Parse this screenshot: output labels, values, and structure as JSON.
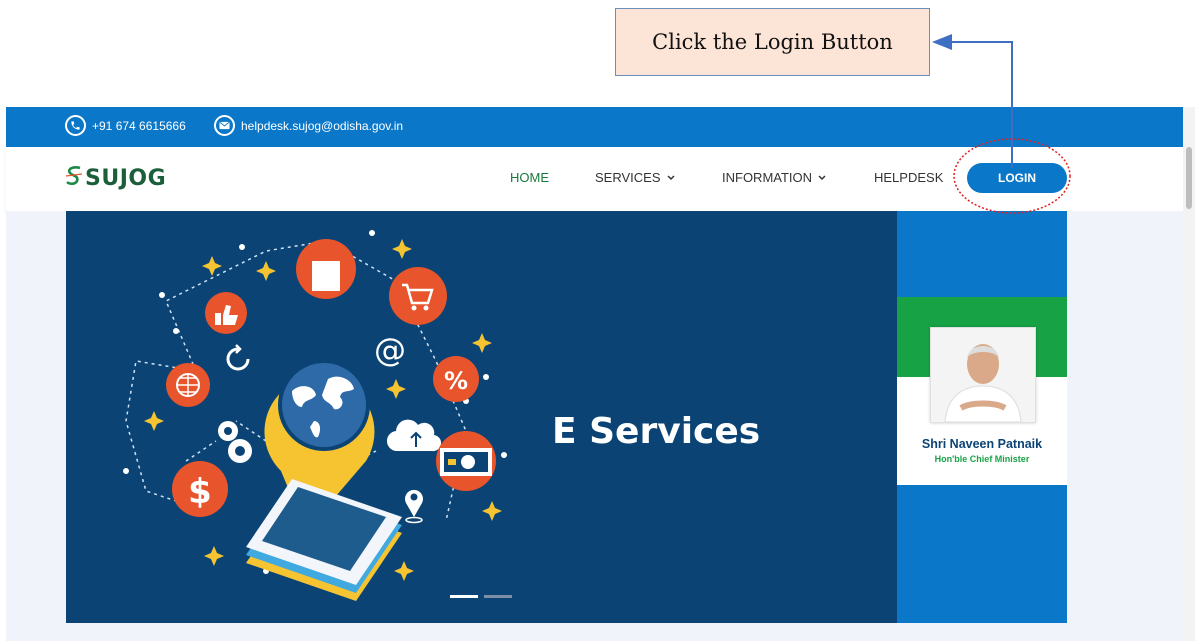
{
  "annotation": {
    "text": "Click the Login Button"
  },
  "topbar": {
    "phone": "+91 674 6615666",
    "email": "helpdesk.sujog@odisha.gov.in"
  },
  "nav": {
    "logo": "SUJOG",
    "items": [
      {
        "label": "HOME",
        "active": true
      },
      {
        "label": "SERVICES",
        "dropdown": true
      },
      {
        "label": "INFORMATION",
        "dropdown": true
      },
      {
        "label": "HELPDESK"
      }
    ],
    "login": "LOGIN"
  },
  "banner": {
    "title": "E Services",
    "active_slide": 1,
    "slide_count": 2
  },
  "cm": {
    "name": "Shri Naveen Patnaik",
    "title": "Hon'ble Chief Minister"
  },
  "colors": {
    "primary": "#0a77c9",
    "banner": "#0b4375",
    "green": "#17a345",
    "accent": "#e8542b",
    "callout_bg": "#fce4d6"
  },
  "icons": [
    "phone-icon",
    "mail-icon",
    "chevron-down-icon",
    "logo-icon",
    "globe-icon",
    "cart-icon",
    "bag-icon",
    "thumbs-up-icon",
    "percent-icon",
    "dollar-icon",
    "at-icon",
    "cloud-icon",
    "gear-icon",
    "refresh-icon",
    "location-pin-icon",
    "banknote-icon",
    "smartphone-icon"
  ]
}
